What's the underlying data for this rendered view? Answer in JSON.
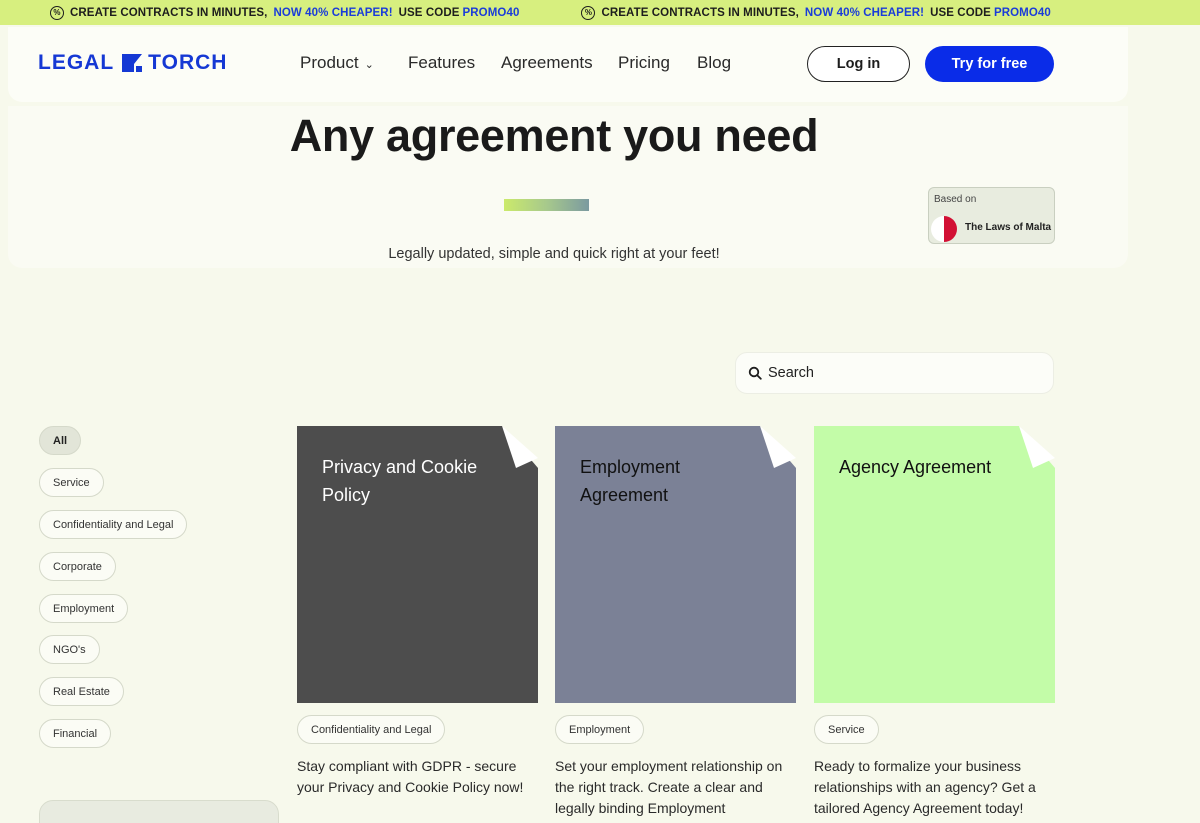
{
  "promo": {
    "items": [
      {
        "pre": "CREATE CONTRACTS IN MINUTES,",
        "highlight": "NOW 40% CHEAPER!",
        "mid": "USE CODE",
        "code": "PROMO40"
      },
      {
        "pre": "CREATE CONTRACTS IN MINUTES,",
        "highlight": "NOW 40% CHEAPER!",
        "mid": "USE CODE",
        "code": "PROMO40"
      }
    ]
  },
  "header": {
    "logo_left": "LEGAL",
    "logo_right": "TORCH",
    "nav": [
      "Product",
      "Features",
      "Agreements",
      "Pricing",
      "Blog"
    ],
    "login_label": "Log in",
    "try_label": "Try for free"
  },
  "hero": {
    "title": "Any agreement you need",
    "subtitle": "Legally updated, simple and quick right at your feet!",
    "badge_label": "Based on",
    "badge_country": "The Laws of Malta"
  },
  "search": {
    "placeholder": "Search"
  },
  "categories": [
    "All",
    "Service",
    "Confidentiality and Legal",
    "Corporate",
    "Employment",
    "NGO's",
    "Real Estate",
    "Financial"
  ],
  "cards": [
    {
      "title": "Privacy and Cookie Policy",
      "tag": "Confidentiality and Legal",
      "description": "Stay compliant with GDPR - secure your Privacy and Cookie Policy now!",
      "color": "#4d4d4d",
      "text_color": "#ffffff"
    },
    {
      "title": "Employment Agreement",
      "tag": "Employment",
      "description": "Set your employment relationship on the right track. Create a clear and legally binding Employment Agreement today!",
      "color": "#7b8196",
      "text_color": "#111111"
    },
    {
      "title": "Agency Agreement",
      "tag": "Service",
      "description": "Ready to formalize your business relationships with an agency? Get a tailored Agency Agreement today!",
      "color": "#c3fca8",
      "text_color": "#111111"
    }
  ],
  "colors": {
    "accent": "#0a2ce8",
    "promo_bg": "#d7ef7f",
    "page_bg": "#f7f9ec"
  }
}
